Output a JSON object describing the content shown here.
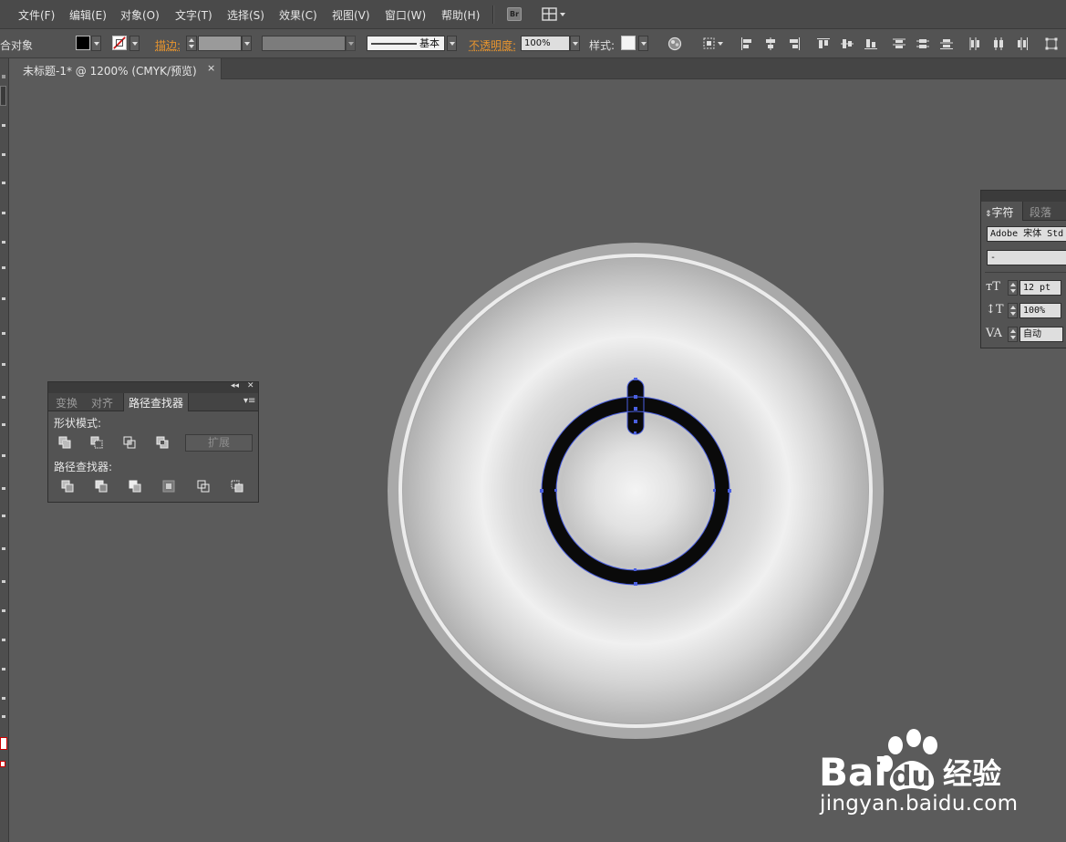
{
  "menu": {
    "items": [
      "文件(F)",
      "编辑(E)",
      "对象(O)",
      "文字(T)",
      "选择(S)",
      "效果(C)",
      "视图(V)",
      "窗口(W)",
      "帮助(H)"
    ],
    "bridge_label": "Br"
  },
  "control_bar": {
    "selection_label": "合对象",
    "stroke_label": "描边:",
    "stroke_profile": "基本",
    "opacity_label": "不透明度:",
    "opacity_value": "100%",
    "style_label": "样式:",
    "fill_color": "#000000",
    "stroke_color": "none"
  },
  "document": {
    "tab_title": "未标题-1* @ 1200% (CMYK/预览)",
    "close_glyph": "×"
  },
  "pathfinder_panel": {
    "collapse_glyph": "◂◂",
    "close_glyph": "✕",
    "menu_glyph": "▾≡",
    "tabs": [
      "变换",
      "对齐",
      "路径查找器"
    ],
    "active_tab": "路径查找器",
    "shape_modes_label": "形状模式:",
    "expand_label": "扩展",
    "pathfinders_label": "路径查找器:",
    "shape_mode_icons": [
      "unite-icon",
      "minus-front-icon",
      "intersect-icon",
      "exclude-icon"
    ],
    "pathfinder_icons": [
      "divide-icon",
      "trim-icon",
      "merge-icon",
      "crop-icon",
      "outline-icon",
      "minus-back-icon"
    ]
  },
  "character_panel": {
    "tabs": [
      "字符",
      "段落"
    ],
    "font_family": "Adobe 宋体 Std",
    "font_style": "-",
    "font_size": "12 pt",
    "leading": "100%",
    "tracking": "自动"
  },
  "artwork": {
    "description_colors": {
      "outer_ring": "#a9a9a9",
      "highlight_ring": "#ececec",
      "power_symbol": "#0a0a0a",
      "selection": "#4a5fe0"
    }
  },
  "watermark": {
    "brand": "Bai du 经验",
    "url": "jingyan.baidu.com"
  }
}
